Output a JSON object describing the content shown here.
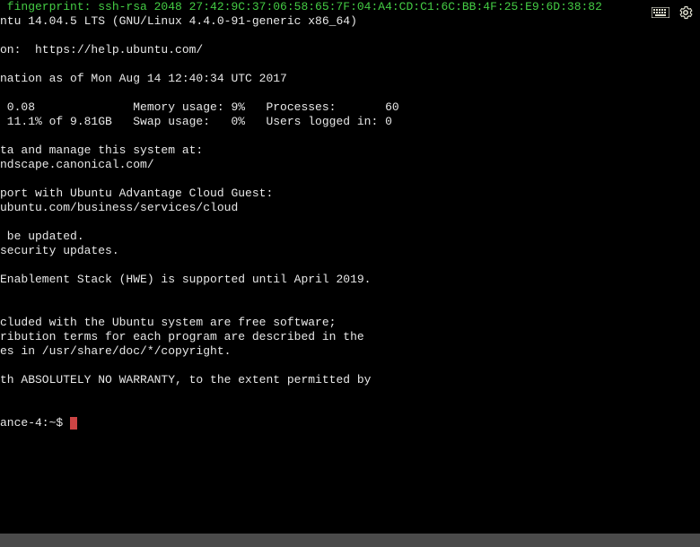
{
  "icons": {
    "keyboard": "keyboard-icon",
    "gear": "gear-icon"
  },
  "terminal": {
    "fingerprint_line": " fingerprint: ssh-rsa 2048 27:42:9C:37:06:58:65:7F:04:A4:CD:C1:6C:BB:4F:25:E9:6D:38:82",
    "lines": [
      "ntu 14.04.5 LTS (GNU/Linux 4.4.0-91-generic x86_64)",
      "",
      "on:  https://help.ubuntu.com/",
      "",
      "nation as of Mon Aug 14 12:40:34 UTC 2017",
      "",
      " 0.08              Memory usage: 9%   Processes:       60",
      " 11.1% of 9.81GB   Swap usage:   0%   Users logged in: 0",
      "",
      "ta and manage this system at:",
      "ndscape.canonical.com/",
      "",
      "port with Ubuntu Advantage Cloud Guest:",
      "ubuntu.com/business/services/cloud",
      "",
      " be updated.",
      "security updates.",
      "",
      "Enablement Stack (HWE) is supported until April 2019.",
      "",
      "",
      "cluded with the Ubuntu system are free software;",
      "ribution terms for each program are described in the",
      "es in /usr/share/doc/*/copyright.",
      "",
      "th ABSOLUTELY NO WARRANTY, to the extent permitted by",
      "",
      ""
    ],
    "prompt": "ance-4:~$ "
  }
}
